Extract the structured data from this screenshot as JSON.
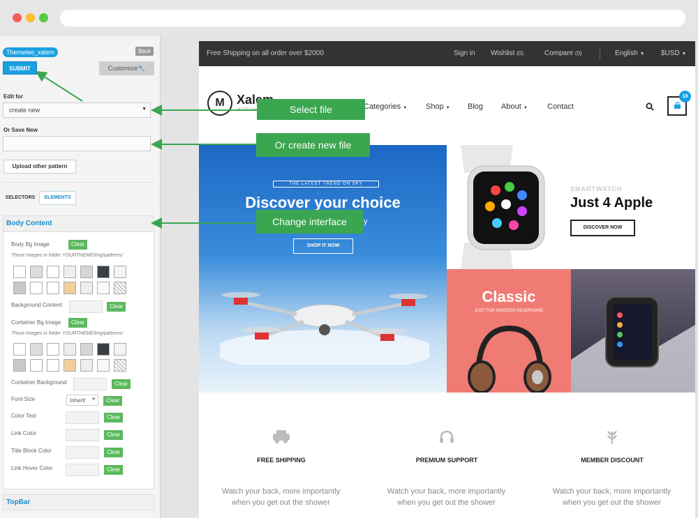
{
  "browser": {
    "url": ""
  },
  "panel": {
    "theme_name": "Themeleo_xalem",
    "back_label": "Back",
    "submit_label": "SUBMIT",
    "customize_label": "Customize",
    "edit_for_label": "Edit for",
    "edit_for_value": "create new",
    "save_new_label": "Or Save New",
    "save_new_value": "",
    "upload_label": "Upload other pattern",
    "tab_selectors": "SELECTORS",
    "tab_elements": "ELEMENTS",
    "body_content_title": "Body Content",
    "body_bg_image": "Body Bg Image",
    "clear": "Clear",
    "folder_note": "Those Images in folder YOURTHEME/img/patterns/",
    "background_content": "Background Content",
    "container_bg_image": "Container Bg Image",
    "container_background": "Container Background",
    "font_size": "Font-Size",
    "font_size_value": "Inherit",
    "color_text": "Color Text",
    "link_color": "Link Color",
    "title_block_color": "Title Block Color",
    "link_hover_color": "Link Hover Color",
    "topbar_title": "TopBar"
  },
  "site": {
    "shipping_note": "Free Shipping on all order over $2000",
    "sign_in": "Sign in",
    "wishlist": "Wishlist",
    "wishlist_count": "(0)",
    "compare": "Compare",
    "compare_count": "(0)",
    "language": "English",
    "currency": "$USD",
    "logo_letter": "M",
    "logo_text": "Xalem",
    "logo_tag": "HITECH",
    "nav": [
      "Categories",
      "Shop",
      "Blog",
      "About",
      "Contact"
    ],
    "cart_count": "18",
    "hero_tag": "THE LATEST TREND ON SKY",
    "hero_title": "Discover your choice",
    "hero_sub": "y",
    "hero_button": "SHOP IT NOW",
    "watch_tag": "SMARTWATCH",
    "watch_title": "Just 4 Apple",
    "watch_button": "DISCOVER NOW",
    "classic_title": "Classic",
    "classic_sub": "JUST FOR WOODEN HEADPHONE",
    "features": [
      {
        "title": "FREE SHIPPING",
        "desc": "Watch your back, more importantly when you get out the shower"
      },
      {
        "title": "PREMIUM SUPPORT",
        "desc": "Watch your back, more importantly when you get out the shower"
      },
      {
        "title": "MEMBER DISCOUNT",
        "desc": "Watch your back, more importantly when you get out the shower"
      }
    ]
  },
  "callouts": {
    "select_file": "Select file",
    "create_file": "Or create new file",
    "change_interface": "Change interface"
  },
  "colors": {
    "accent": "#1aa1e1",
    "callout": "#3aa650",
    "clear": "#5cb85c",
    "topbar": "#333333",
    "classic": "#f07b74"
  }
}
